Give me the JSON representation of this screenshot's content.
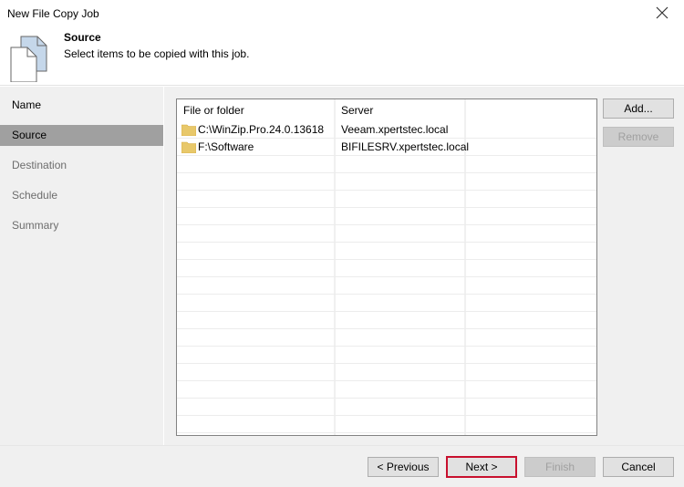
{
  "window": {
    "title": "New File Copy Job",
    "close_icon": "close-icon"
  },
  "header": {
    "icon": "file-copy-icon",
    "title": "Source",
    "subtitle": "Select items to be copied with this job."
  },
  "sidebar": {
    "items": [
      {
        "label": "Name",
        "state": "done"
      },
      {
        "label": "Source",
        "state": "active"
      },
      {
        "label": "Destination",
        "state": "pending"
      },
      {
        "label": "Schedule",
        "state": "pending"
      },
      {
        "label": "Summary",
        "state": "pending"
      }
    ]
  },
  "list": {
    "columns": [
      "File or folder",
      "Server",
      ""
    ],
    "rows": [
      {
        "icon": "folder-icon",
        "path": "C:\\WinZip.Pro.24.0.13618",
        "server": "Veeam.xpertstec.local"
      },
      {
        "icon": "folder-icon",
        "path": "F:\\Software",
        "server": "BIFILESRV.xpertstec.local"
      }
    ]
  },
  "side_buttons": {
    "add": "Add...",
    "remove": "Remove"
  },
  "footer": {
    "previous": "< Previous",
    "next": "Next >",
    "finish": "Finish",
    "cancel": "Cancel"
  },
  "colors": {
    "focus_border": "#c8102e",
    "active_nav": "#a0a0a0",
    "folder": "#e8c86a"
  }
}
